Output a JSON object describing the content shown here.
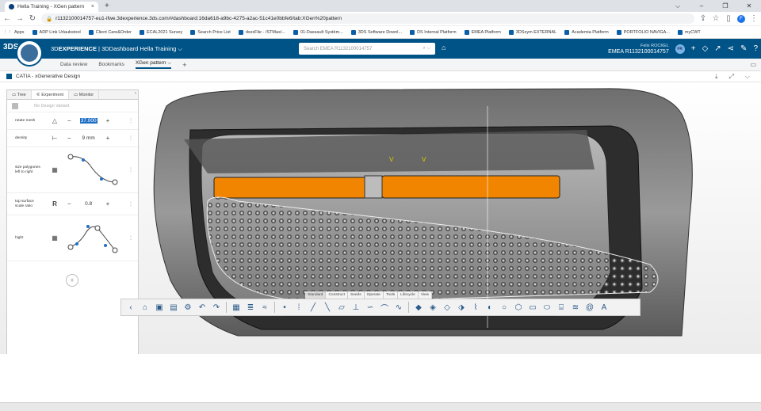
{
  "browser": {
    "tab_title": "Hella Training - XGen pattern",
    "tab_close": "×",
    "new_tab": "+",
    "window_controls": [
      "⌵",
      "–",
      "❐",
      "✕"
    ],
    "url": "r1132100014757-eu1-ifwe.3dexperience.3ds.com/#dashboard:16da618-a9bc-4275-a2ac-51c41e0bbfe6/tab:XGen%20pattern",
    "profile_initial": "F"
  },
  "bookmarks": [
    "Apps",
    "ADP Link Urlaubstool",
    "Client Care&Order",
    "ECAL2021 Survey",
    "Search Price List",
    "dsxxFile - /STMax/...",
    "01-Dassault Systèm...",
    "3DS Software Downl...",
    "DS Internal Platform",
    "EMEA Platform",
    "3DSxym EXTERNAL",
    "Academia Platform",
    "PORTFOLIO NAVIGA...",
    "myCWT"
  ],
  "dashboard": {
    "brand_logo": "3DS",
    "title_plain": "3D",
    "title_bold": "EXPERIENCE",
    "title_rest": " | 3DDashboard  Hella Training",
    "search_placeholder": "Search EMEA R1132100014757",
    "user_name": "Felix ROCKEL",
    "tenant": "EMEA R1132100014757",
    "user_initials": "FR",
    "notif_count": "4"
  },
  "dashboard_tabs": [
    {
      "label": "Data review"
    },
    {
      "label": "Bookmarks"
    },
    {
      "label": "XGen pattern"
    }
  ],
  "app": {
    "title": "CATIA - xGenerative Design"
  },
  "panel": {
    "tabs": [
      "Tree",
      "Experiment",
      "Monitor"
    ],
    "variant": "No Design Variant",
    "params": [
      {
        "label": "rotate mesh",
        "icon": "△",
        "value": "37.000",
        "unit": "",
        "selected": true
      },
      {
        "label": "density",
        "icon": "⊢",
        "value": "9 mm",
        "unit": "",
        "selected": false
      },
      {
        "label": "size polygones left to right",
        "icon": "▦",
        "value": "",
        "unit": "",
        "selected": false
      },
      {
        "label": "top surface scale ratio",
        "icon": "R",
        "value": "0.8",
        "unit": "",
        "selected": false
      },
      {
        "label": "hight",
        "icon": "▦",
        "value": "",
        "unit": "",
        "selected": false
      }
    ],
    "add": "+"
  },
  "command_tabs": [
    {
      "label": "Standard"
    },
    {
      "label": "Construct"
    },
    {
      "label": "Seeds"
    },
    {
      "label": "Operate"
    },
    {
      "label": "Tools"
    },
    {
      "label": "Lifecycle"
    },
    {
      "label": "View"
    }
  ]
}
